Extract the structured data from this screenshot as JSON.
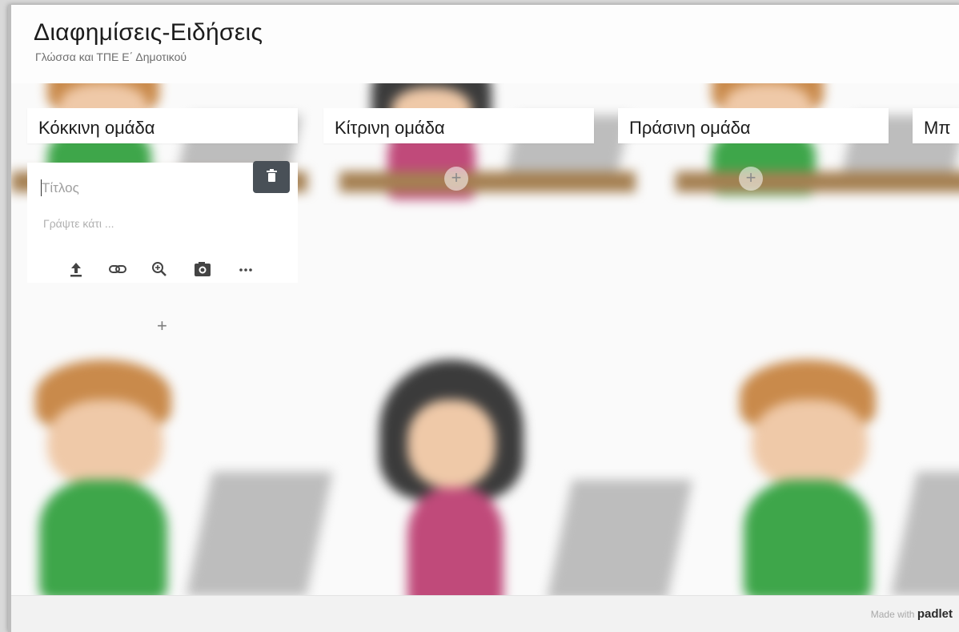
{
  "header": {
    "title": "Διαφημίσεις-Ειδήσεις",
    "subtitle": "Γλώσσα και ΤΠΕ Ε΄ Δημοτικού"
  },
  "columns": [
    {
      "label": "Κόκκινη ομάδα"
    },
    {
      "label": "Κίτρινη ομάδα"
    },
    {
      "label": "Πράσινη ομάδα"
    },
    {
      "label": "Μπ"
    }
  ],
  "composer": {
    "title_placeholder": "Τίτλος",
    "body_placeholder": "Γράψτε κάτι ...",
    "tools": [
      "upload-icon",
      "link-icon",
      "search-zoom-icon",
      "camera-icon",
      "more-icon"
    ]
  },
  "add_symbol": "+",
  "footer": {
    "made_with": "Made with",
    "brand": "padlet"
  },
  "colors": {
    "trash_button": "#495057",
    "footer_bg": "#f2f2f2"
  }
}
